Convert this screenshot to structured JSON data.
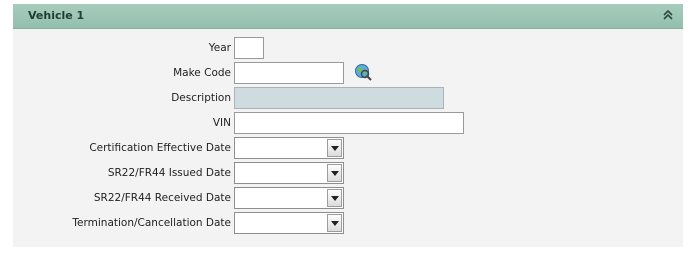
{
  "panel": {
    "title": "Vehicle 1",
    "collapse_icon": "double-chevron-up-icon"
  },
  "fields": {
    "year": {
      "label": "Year",
      "value": ""
    },
    "make_code": {
      "label": "Make Code",
      "value": "",
      "lookup_icon": "globe-search-icon"
    },
    "description": {
      "label": "Description",
      "value": ""
    },
    "vin": {
      "label": "VIN",
      "value": ""
    },
    "cert_effective_date": {
      "label": "Certification Effective Date",
      "value": ""
    },
    "sr22_issued_date": {
      "label": "SR22/FR44 Issued Date",
      "value": ""
    },
    "sr22_received_date": {
      "label": "SR22/FR44 Received Date",
      "value": ""
    },
    "termination_date": {
      "label": "Termination/Cancellation Date",
      "value": ""
    }
  },
  "colors": {
    "header": "#9ec6b6",
    "panel_bg": "#f3f3f3",
    "readonly_field": "#cfdcdf"
  }
}
